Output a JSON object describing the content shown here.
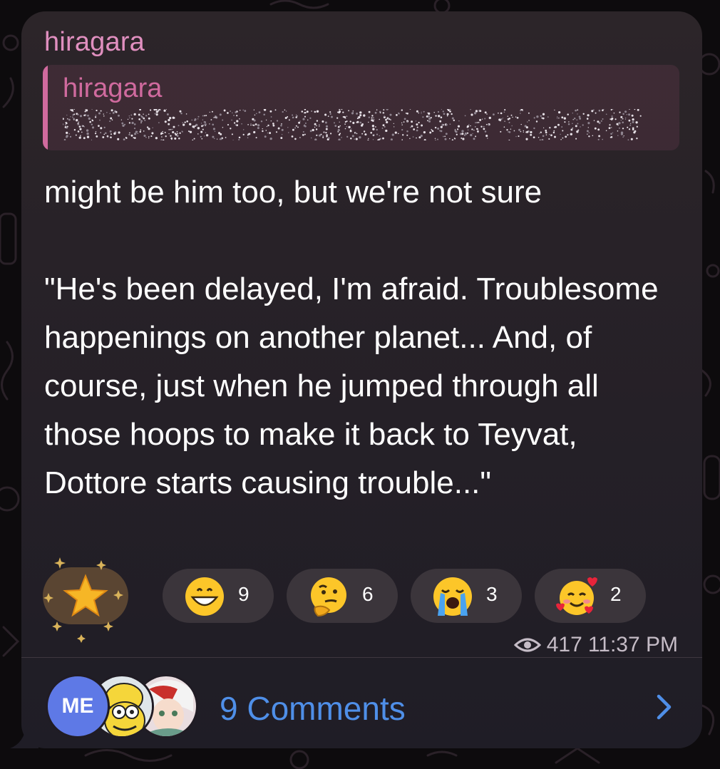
{
  "post": {
    "channel_name": "hiragara",
    "reply": {
      "author": "hiragara"
    },
    "text": "might be him too, but we're not sure\n\n\"He's been delayed, I'm afraid. Troublesome happenings on another planet... And, of course, just when he jumped through all those hoops to make it back to Teyvat, Dottore starts causing trouble...\""
  },
  "reactions": [
    {
      "emoji": "star",
      "count": ""
    },
    {
      "emoji": "grinning-face",
      "count": "9"
    },
    {
      "emoji": "thinking-face",
      "count": "6"
    },
    {
      "emoji": "loudly-crying-face",
      "count": "3"
    },
    {
      "emoji": "smiling-face-with-hearts",
      "count": "2"
    }
  ],
  "meta": {
    "views": "417",
    "time": "11:37 PM"
  },
  "comments": {
    "label": "9 Comments",
    "avatars": [
      {
        "type": "initials",
        "text": "ME"
      },
      {
        "type": "image",
        "icon": "cartoon-avatar"
      },
      {
        "type": "image",
        "icon": "anime-avatar"
      }
    ]
  },
  "colors": {
    "channel_name": "#e08fbf",
    "reply_accent": "#d06a9e",
    "link": "#4f8fe8",
    "avatar_me": "#5e79e6"
  }
}
